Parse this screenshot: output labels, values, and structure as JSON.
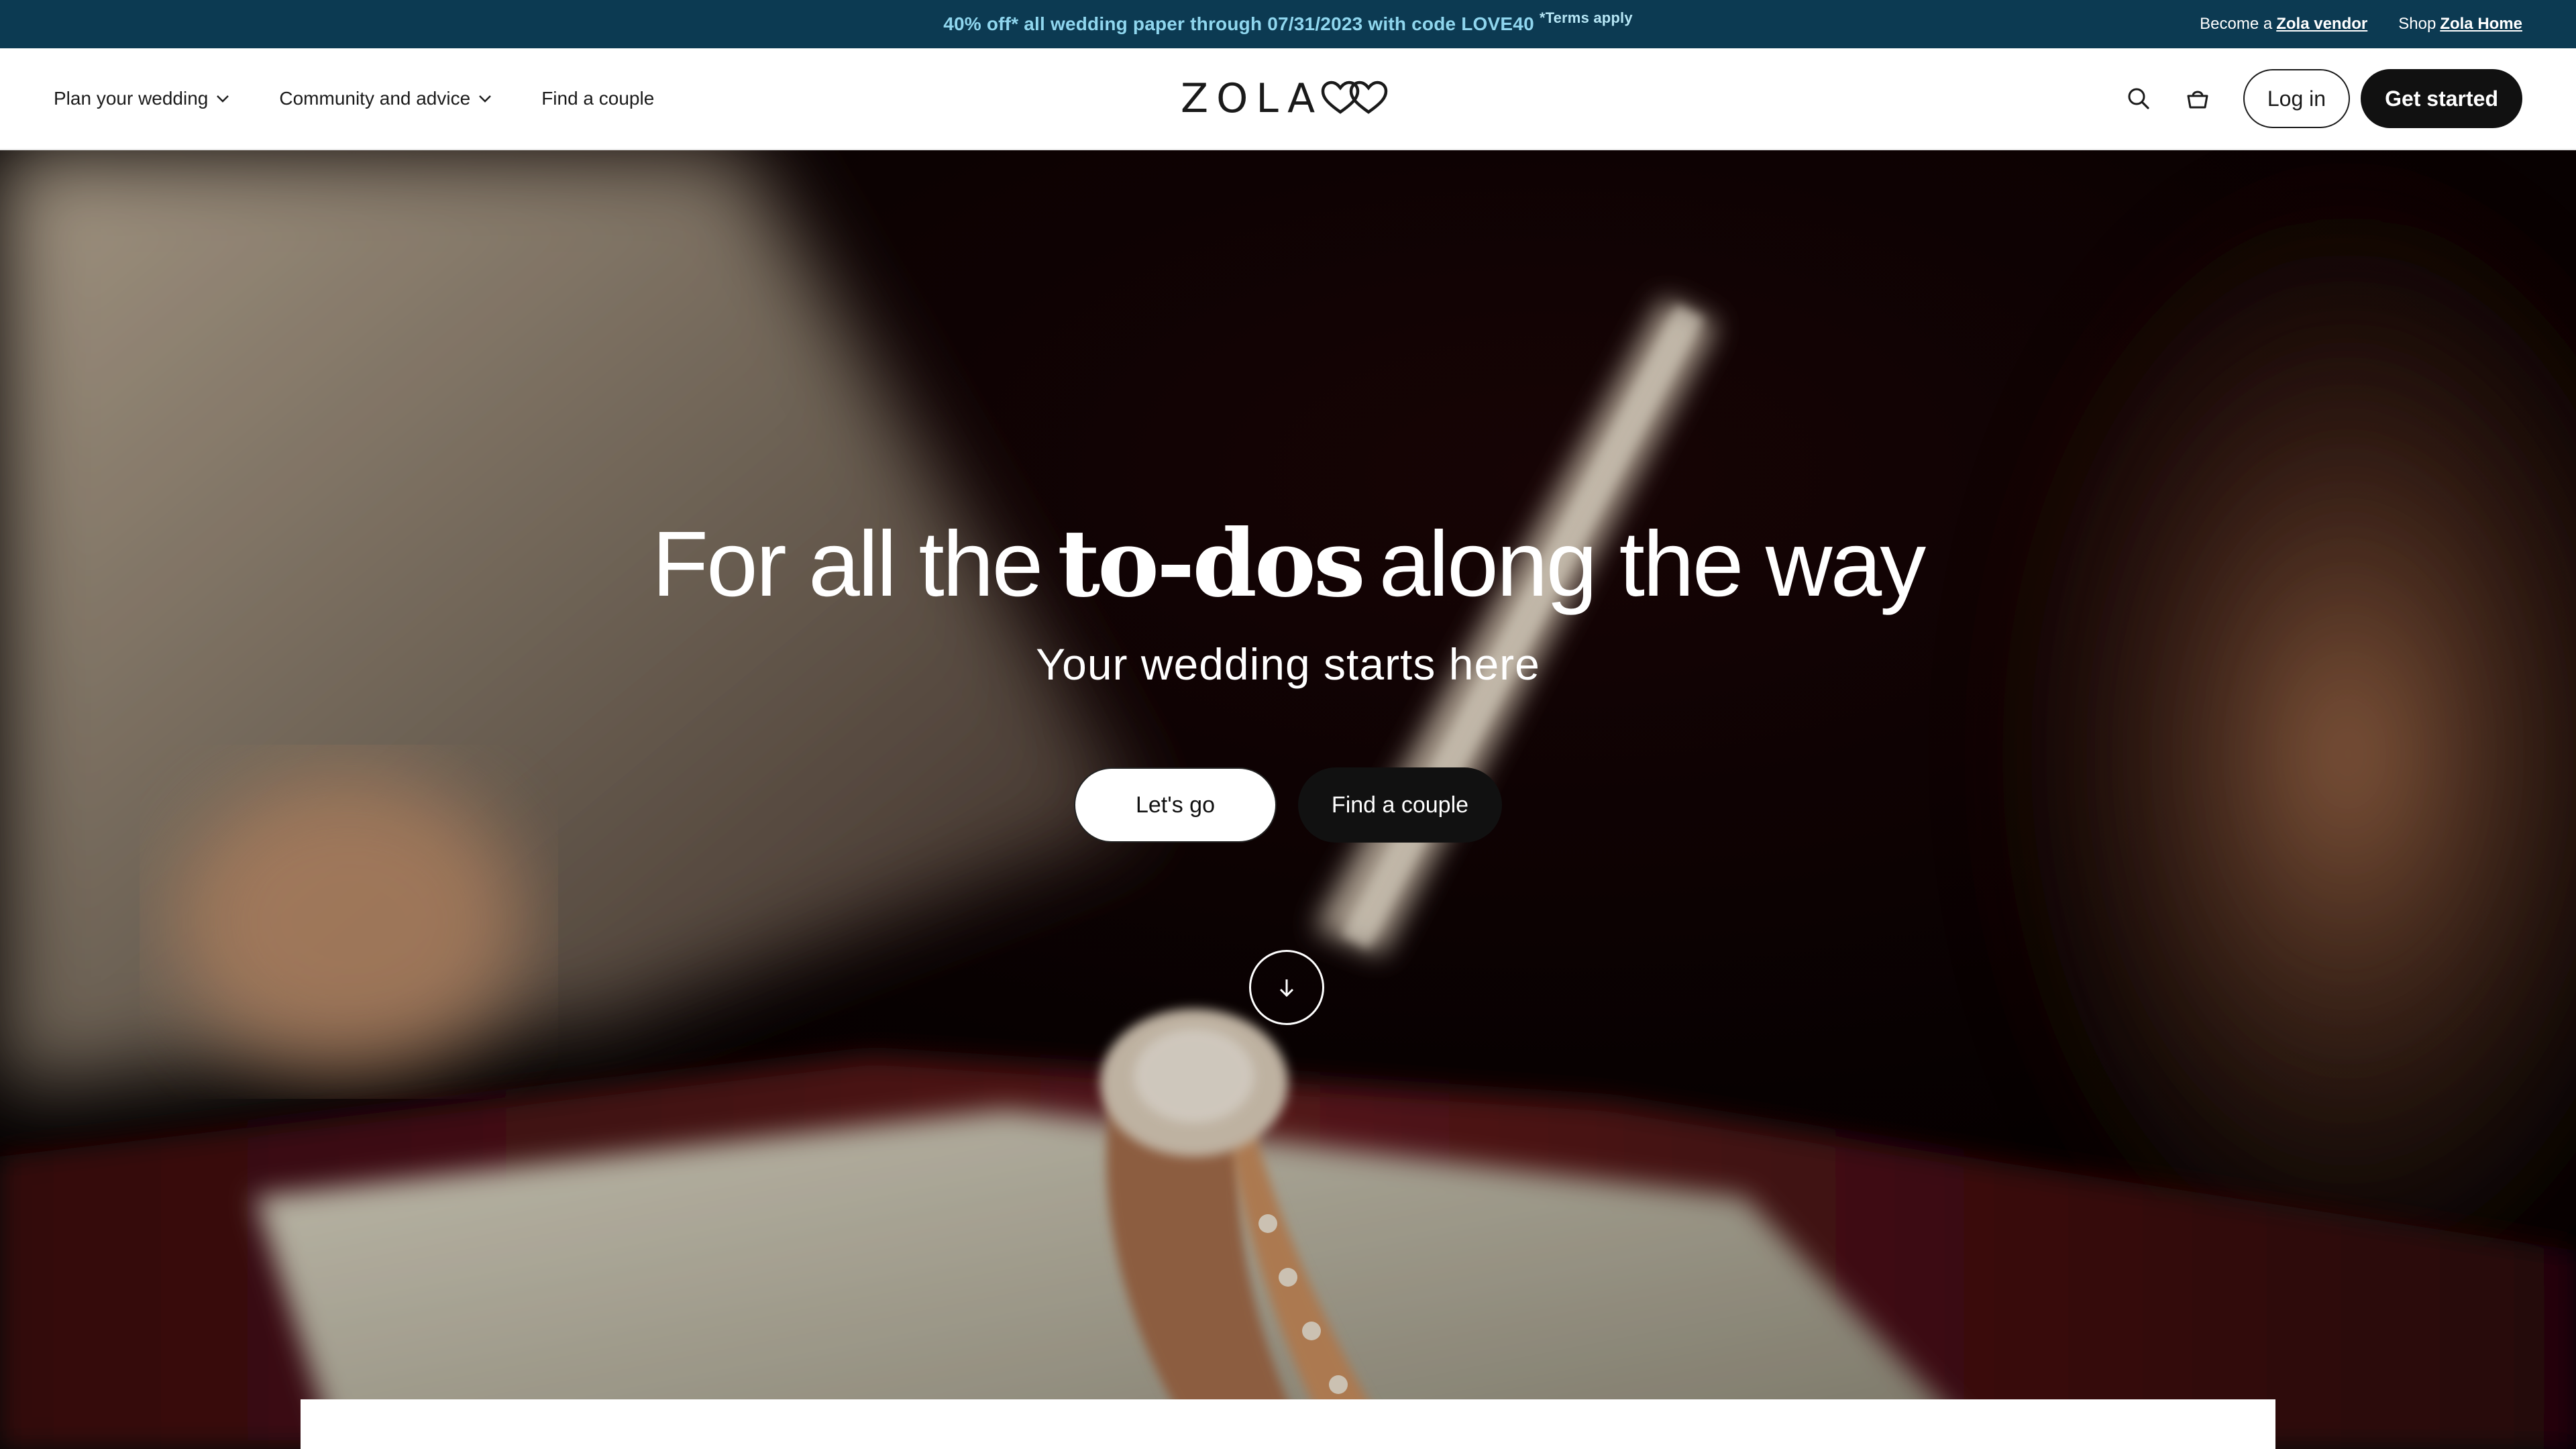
{
  "promo": {
    "text": "40% off* all wedding paper through 07/31/2023 with code LOVE40",
    "terms": "*Terms apply",
    "vendor_prefix": "Become a",
    "vendor_link": "Zola vendor",
    "shop_prefix": "Shop",
    "shop_link": "Zola Home",
    "background_color": "#0c3a52",
    "text_color": "#8fd6ee"
  },
  "header": {
    "nav": [
      {
        "label": "Plan your wedding",
        "icon": "chevron-down-icon"
      },
      {
        "label": "Community and advice",
        "icon": "chevron-down-icon"
      },
      {
        "label": "Find a couple"
      }
    ],
    "logo_text": "ZOLA",
    "logo_icon": "double-heart-icon",
    "search_icon": "search-icon",
    "cart_icon": "shopping-bag-icon",
    "login_label": "Log in",
    "start_label": "Get started"
  },
  "hero": {
    "headline_before": "For all the",
    "headline_emphasis": "to-dos",
    "headline_after": "along the way",
    "subheadline": "Your wedding starts here",
    "primary_cta": "Let's go",
    "secondary_cta": "Find a couple",
    "scroll_icon": "arrow-down-icon",
    "background_description_icon": "engagement-ring-photo"
  }
}
